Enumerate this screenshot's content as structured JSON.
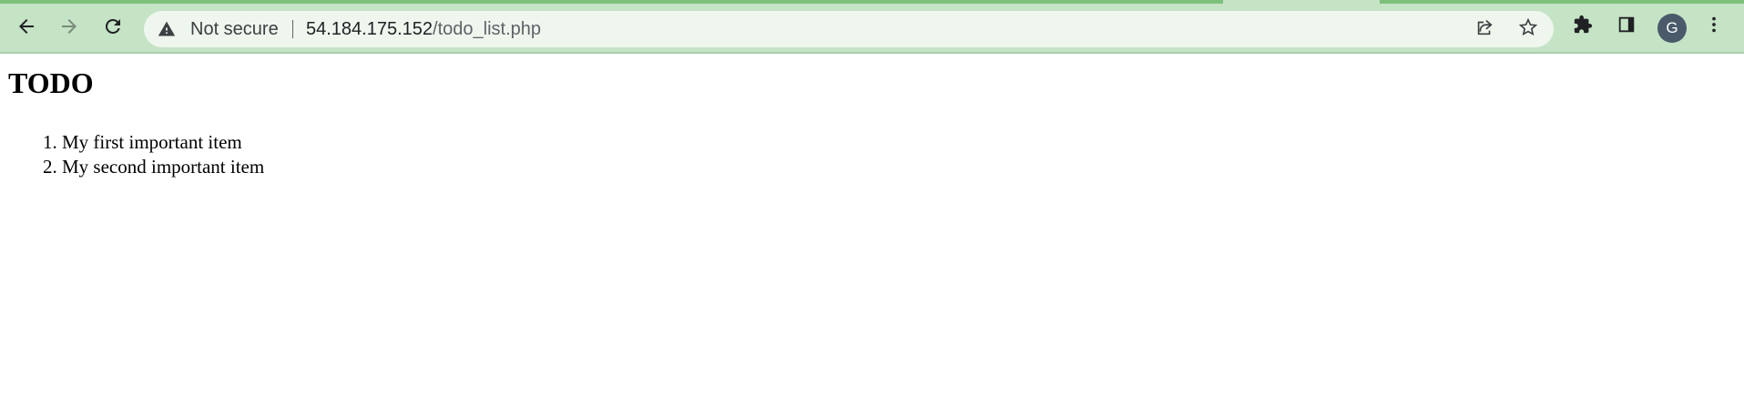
{
  "browser": {
    "security_label": "Not secure",
    "url_host": "54.184.175.152",
    "url_path": "/todo_list.php",
    "profile_initial": "G",
    "icons": {
      "back": "arrow-left",
      "forward": "arrow-right",
      "reload": "reload",
      "security": "warning-triangle",
      "share": "share",
      "bookmark": "star",
      "extensions": "puzzle-piece",
      "side_panel": "side-panel",
      "menu": "three-dots-vertical"
    },
    "colors": {
      "chrome_background": "#c5e3c5",
      "tab_accent": "#7cc07c",
      "omnibox_background": "#eef6ee",
      "avatar_background": "#4a5a6b"
    }
  },
  "page": {
    "heading": "TODO",
    "items": [
      "My first important item",
      "My second important item"
    ]
  }
}
